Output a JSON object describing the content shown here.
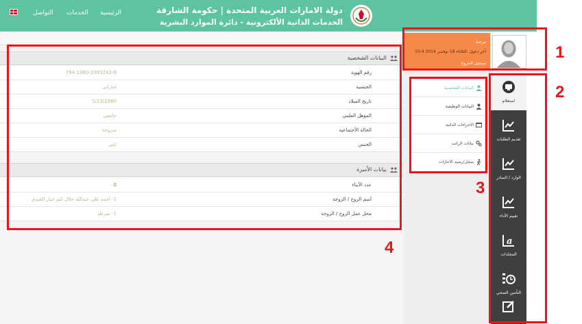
{
  "header": {
    "title_line1": "دولة الامارات العربية المتحدة | حكومة الشارقة",
    "title_line2": "الخدمات الذاتية الألكترونية - دائرة الموارد البشرية",
    "nav": [
      {
        "label": "الرئيسية"
      },
      {
        "label": "الخدمات"
      },
      {
        "label": "التواصل"
      }
    ],
    "language_flag": "uk-flag-icon"
  },
  "profile": {
    "greeting": "مرحبا،",
    "last_login": "آخر دخول :الثلاثاء 18 نوفمبر 2014 10:4",
    "logout_label": "تسجيل الخروج",
    "color": "#f6894a"
  },
  "sidebar": {
    "items": [
      {
        "label": "استعلام",
        "icon": "monitor-icon",
        "active": true
      },
      {
        "label": "تقديم الطلبات",
        "icon": "line-chart-icon"
      },
      {
        "label": "الوارد / الصادر",
        "icon": "line-chart-icon"
      },
      {
        "label": "تقييم الأداء",
        "icon": "line-chart-icon"
      },
      {
        "label": "المجلدات",
        "icon": "text-icon"
      },
      {
        "label": "التأمين الصحي",
        "icon": "clock-icon"
      },
      {
        "label": "",
        "icon": "edit-icon"
      }
    ]
  },
  "submenu": {
    "items": [
      {
        "label": "البيانات الشخصية",
        "icon": "user-icon",
        "active": true
      },
      {
        "label": "البيانات الوظيفية",
        "icon": "user-icon"
      },
      {
        "label": "الاجراءات الذاتية",
        "icon": "window-icon"
      },
      {
        "label": "بيانات الراتب",
        "icon": "gears-icon"
      },
      {
        "label": "سجل/رصيد الاجازات",
        "icon": "walk-icon"
      }
    ]
  },
  "personal": {
    "heading": "البيانات الشخصية",
    "rows": [
      {
        "label": "رقم الهوية",
        "value": "784-1980-2083242-9"
      },
      {
        "label": "الجنسية",
        "value": "اماراتي"
      },
      {
        "label": "تاريخ الميلاد",
        "value": "5/13/1980"
      },
      {
        "label": "المؤهل العلمي",
        "value": "جامعي"
      },
      {
        "label": "الحالة الأجتماعية",
        "value": "متزوجة"
      },
      {
        "label": "الجنس",
        "value": "انثى"
      }
    ]
  },
  "family": {
    "heading": "بيانات الأسرة",
    "rows": [
      {
        "label": "عدد الأبناء",
        "value": "0"
      },
      {
        "label": "أسم الزوج / الزوجة",
        "value": "1- أحمد علي عبدالله خلال كتم حبار الحيدي"
      },
      {
        "label": "محل عمل الزوج / الزوجة",
        "value": "1- شرطة"
      }
    ]
  },
  "annotations": [
    "1",
    "2",
    "3",
    "4"
  ],
  "colors": {
    "header": "#5ec3a1",
    "annotation": "#e8161b",
    "sidebar": "#3f3f3f"
  }
}
